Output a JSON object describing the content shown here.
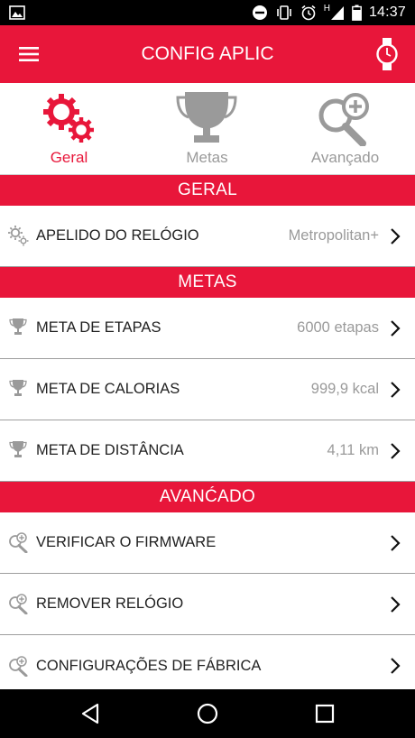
{
  "status_bar": {
    "time": "14:37",
    "icons": [
      "image-icon",
      "do-not-disturb-icon",
      "vibrate-icon",
      "alarm-icon",
      "signal-icon",
      "battery-icon"
    ],
    "network_label": "H"
  },
  "app_bar": {
    "title": "CONFIG APLIC",
    "menu_icon": "hamburger-menu-icon",
    "watch_icon": "watch-icon"
  },
  "tabs": [
    {
      "label": "Geral",
      "icon": "gears-icon",
      "active": true
    },
    {
      "label": "Metas",
      "icon": "trophy-icon",
      "active": false
    },
    {
      "label": "Avançado",
      "icon": "magnifier-plus-icon",
      "active": false
    }
  ],
  "sections": {
    "geral": {
      "header": "GERAL",
      "rows": [
        {
          "label": "APELIDO DO RELÓGIO",
          "value": "Metropolitan+",
          "icon": "gears-icon"
        }
      ]
    },
    "metas": {
      "header": "METAS",
      "rows": [
        {
          "label": "META DE ETAPAS",
          "value": "6000 etapas",
          "icon": "trophy-icon"
        },
        {
          "label": "META DE CALORIAS",
          "value": "999,9 kcal",
          "icon": "trophy-icon"
        },
        {
          "label": "META DE DISTÂNCIA",
          "value": "4,11 km",
          "icon": "trophy-icon"
        }
      ]
    },
    "avancado": {
      "header": "AVANĆADO",
      "rows": [
        {
          "label": "VERIFICAR O FIRMWARE",
          "value": "",
          "icon": "magnifier-plus-icon"
        },
        {
          "label": "REMOVER RELÓGIO",
          "value": "",
          "icon": "magnifier-plus-icon"
        },
        {
          "label": "CONFIGURAÇÕES DE FÁBRICA",
          "value": "",
          "icon": "magnifier-plus-icon"
        }
      ]
    }
  },
  "nav_bar": {
    "buttons": [
      "back-icon",
      "home-icon",
      "recents-icon"
    ]
  },
  "colors": {
    "accent": "#e8163a",
    "inactive_gray": "#9a9a9a"
  }
}
